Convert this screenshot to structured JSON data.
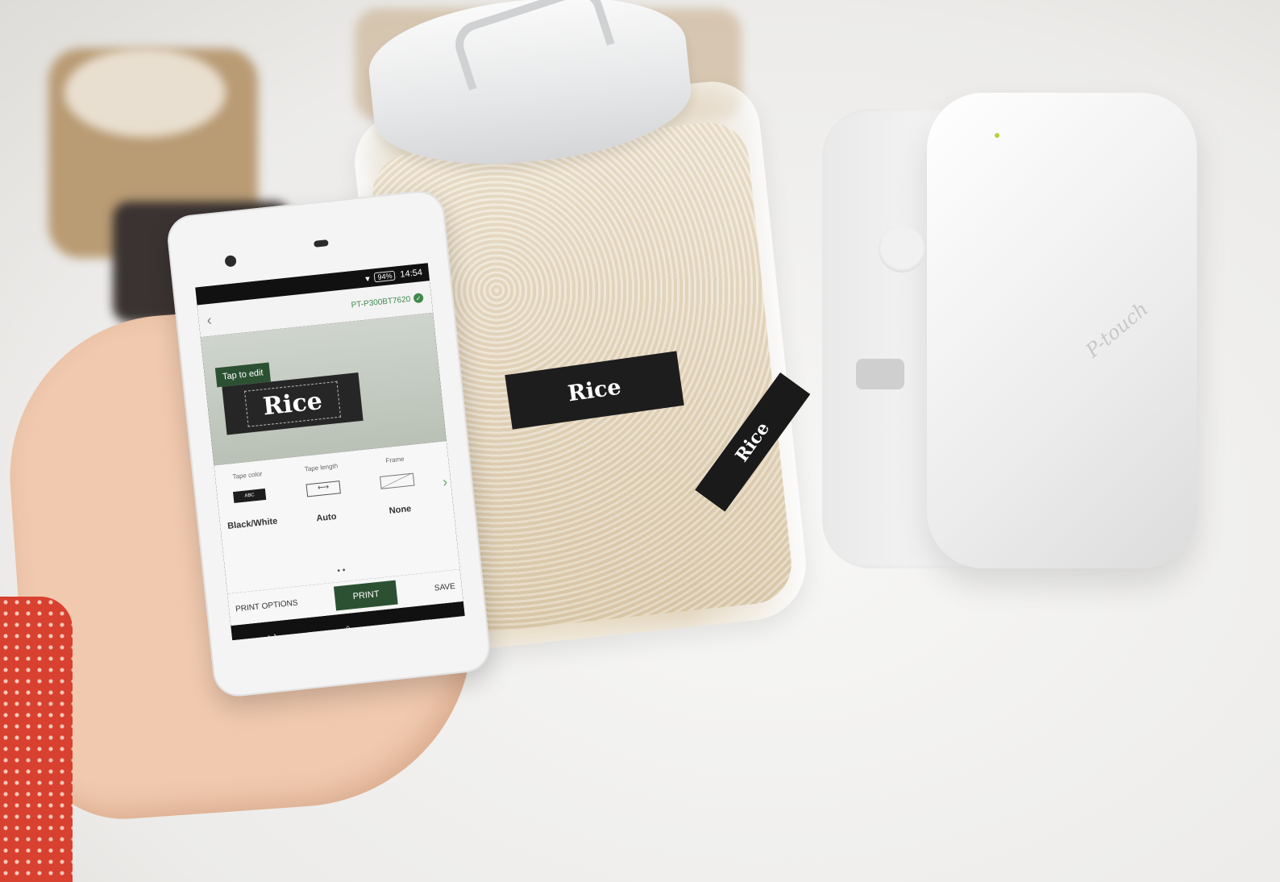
{
  "phone": {
    "status": {
      "battery": "94%",
      "time": "14:54"
    },
    "app": {
      "device_name": "PT-P300BT7620",
      "tap_to_edit": "Tap to edit",
      "label_text": "Rice"
    },
    "options": [
      {
        "title": "Tape color",
        "value": "Black/White",
        "icon_text": "ABC",
        "icon": "tape-color-icon"
      },
      {
        "title": "Tape length",
        "value": "Auto",
        "icon_text": "⟷",
        "icon": "tape-length-icon"
      },
      {
        "title": "Frame",
        "value": "None",
        "icon_text": "",
        "icon": "frame-icon"
      }
    ],
    "actions": {
      "print_options": "PRINT OPTIONS",
      "print": "PRINT",
      "save": "SAVE"
    }
  },
  "scene": {
    "jar_label": "Rice",
    "printed_tape": "Rice",
    "printer_brand": "P-touch"
  },
  "colors": {
    "accent_green": "#2c5132",
    "device_green": "#3f8a4c",
    "label_black": "#1d1d1d"
  }
}
